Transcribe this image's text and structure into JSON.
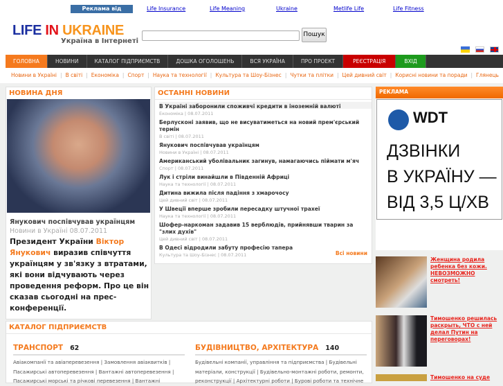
{
  "ads_bar": {
    "badge": "Реклама від Google",
    "links": [
      "Life Insurance",
      "Life Meaning",
      "Ukraine",
      "Metlife Life",
      "Life Fitness"
    ]
  },
  "logo": {
    "w1": "LIFE",
    "w2": "IN",
    "w3": "UKRAINE",
    "slogan": "Україна в Інтернеті"
  },
  "search": {
    "value": "",
    "button": "Пошук"
  },
  "nav": [
    "ГОЛОВНА",
    "НОВИНИ",
    "КАТАЛОГ ПІДПРИЄМСТВ",
    "ДОШКА ОГОЛОШЕНЬ",
    "ВСЯ УКРАЇНА",
    "ПРО ПРОЕКТ",
    "РЕЄСТРАЦІЯ",
    "ВХІД"
  ],
  "subnav": [
    "Новини в Україні",
    "В світі",
    "Економіка",
    "Спорт",
    "Наука та технології",
    "Культура та Шоу-Бізнес",
    "Чутки та плітки",
    "Цей дивний світ",
    "Корисні новини та поради",
    "Глянець"
  ],
  "day_news": {
    "title": "НОВИНА ДНЯ",
    "headline": "Янукович поспівчував українцям",
    "meta": "Новини в Україні 08.07.2011",
    "text1": "Президент України ",
    "link": "Віктор Янукович",
    "text2": " виразив співчуття українцям у зв'язку з втратами, які вони відчувають через проведення реформ. Про це він сказав сьогодні на прес-конференції."
  },
  "latest": {
    "title": "ОСТАННІ НОВИНИ",
    "all": "Всі новини",
    "items": [
      {
        "t": "В Україні заборонили споживчі кредити в іноземній валюті",
        "m": "Економіка  |  08.07.2011"
      },
      {
        "t": "Берлусконі заявив, що не висуватиметься на новий прем'єрський термін",
        "m": "В світі  |  08.07.2011"
      },
      {
        "t": "Янукович поспівчував українцям",
        "m": "Новини в Україні  |  08.07.2011"
      },
      {
        "t": "Американський уболівальник загинув, намагаючись піймати м'яч",
        "m": "Спорт  |  08.07.2011"
      },
      {
        "t": "Лук і стріли винайшли в Південній Африці",
        "m": "Наука та технології  |  08.07.2011"
      },
      {
        "t": "Дитина вижила після падіння з хмарочосу",
        "m": "Цей дивний світ  |  08.07.2011"
      },
      {
        "t": "У Швеції вперше зробили пересадку штучної трахеї",
        "m": "Наука та технології  |  08.07.2011"
      },
      {
        "t": "Шофер-наркоман задавив 15 верблюдів, прийнявши тварин за \"злих духів\"",
        "m": "Цей дивний світ  |  08.07.2011"
      },
      {
        "t": "В Одесі відродили забуту професію тапера",
        "m": "Культура та Шоу-Бізнес  |  08.07.2011"
      }
    ]
  },
  "ad": {
    "title": "РЕКЛАМА",
    "brand": "WDT",
    "l1": "ДЗВІНКИ",
    "l2": "В УКРАЇНУ —",
    "l3": "ВІД 3,5 Ц/ХВ"
  },
  "promos": [
    "Женщина родила ребенка без кожи. НЕВОЗМОЖНО смотреть!",
    "Тимошенко решилась раскрыть, ЧТО с ней делал Путин на переговорах!",
    "Тимошенко на суде"
  ],
  "catalog": {
    "title": "КАТАЛОГ ПІДПРИЄМСТВ",
    "cats": [
      {
        "name": "ТРАНСПОРТ",
        "count": "62",
        "text": "Авіакомпанії та авіаперевезення | Замовлення авіаквитків | Пасажирські автоперевезення | Вантажні автоперевезення | Пасажирські морські та річкові перевезення | Вантажні"
      },
      {
        "name": "БУДІВНИЦТВО, АРХІТЕКТУРА",
        "count": "140",
        "text": "Будівельні компанії, управління та підприємства | Будівельні матеріали, конструкції | Будівельно-монтажні роботи, ремонти, реконструкції | Архітектурні роботи | Бурові роботи та технічне"
      }
    ]
  }
}
